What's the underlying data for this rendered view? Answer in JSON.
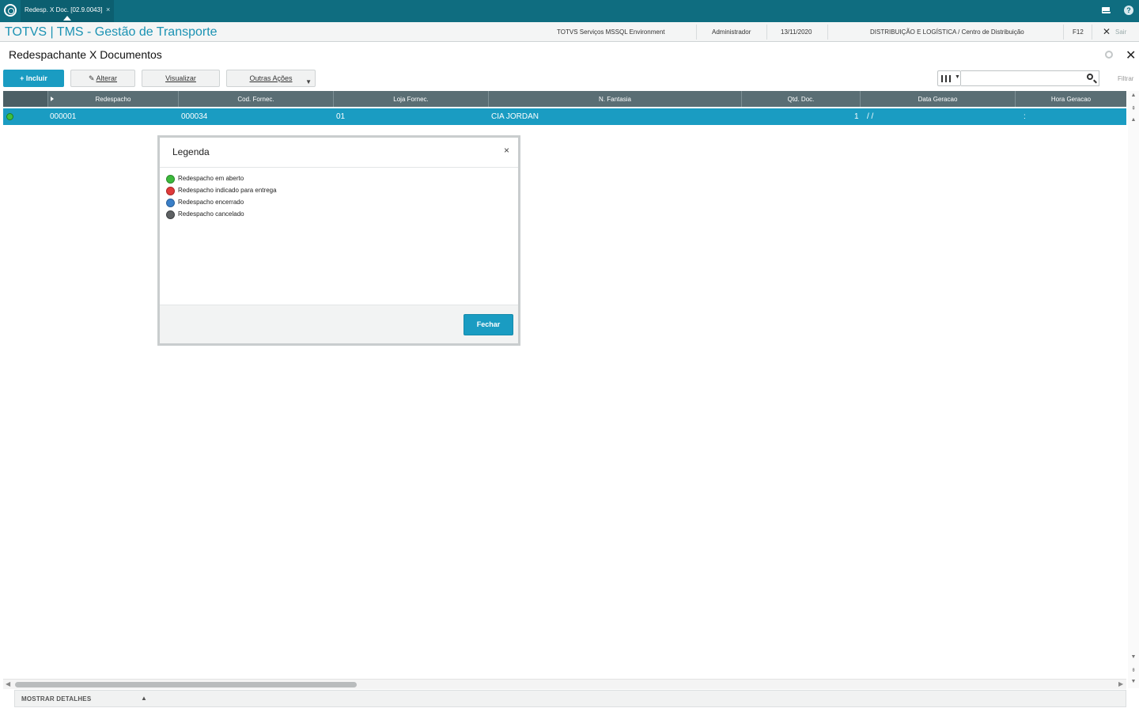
{
  "topbar": {
    "tab_label": "Redesp. X Doc. [02.9.0043]",
    "tab_close": "×",
    "help": "?"
  },
  "header": {
    "app_title": "TOTVS | TMS - Gestão de Transporte",
    "environment": "TOTVS Serviços MSSQL Environment",
    "user": "Administrador",
    "date": "13/11/2020",
    "branch": "DISTRIBUIÇÃO E LOGÍSTICA / Centro de Distribuição",
    "shortcut": "F12",
    "exit_label": "Sair"
  },
  "page": {
    "title": "Redespachante X Documentos"
  },
  "toolbar": {
    "incluir": "+ Incluir",
    "alterar": "Alterar",
    "visualizar": "Visualizar",
    "outras_acoes": "Outras Ações",
    "filter_label": "Filtrar",
    "search_placeholder": ""
  },
  "grid": {
    "columns": [
      "Redespacho",
      "Cod. Fornec.",
      "Loja Fornec.",
      "N. Fantasia",
      "Qtd. Doc.",
      "Data Geracao",
      "Hora Geracao"
    ],
    "rows": [
      {
        "status": "green",
        "redespacho": "000001",
        "cod_fornec": "000034",
        "loja_fornec": "01",
        "n_fantasia": "CIA JORDAN",
        "qtd_doc": "1",
        "data_geracao": "/ /",
        "hora_geracao": ":"
      }
    ]
  },
  "details": {
    "label": "MOSTRAR DETALHES"
  },
  "legend_dialog": {
    "title": "Legenda",
    "close": "×",
    "items": [
      {
        "label": "Redespacho em aberto",
        "color": "#3cb93c"
      },
      {
        "label": "Redespacho indicado para entrega",
        "color": "#e03a3a"
      },
      {
        "label": "Redespacho encerrado",
        "color": "#3a7fc8"
      },
      {
        "label": "Redespacho cancelado",
        "color": "#5e6163"
      }
    ],
    "button": "Fechar"
  },
  "colors": {
    "topbar": "#0f6d80",
    "accent": "#1a9cc2",
    "grid_header": "#5a6e74"
  }
}
